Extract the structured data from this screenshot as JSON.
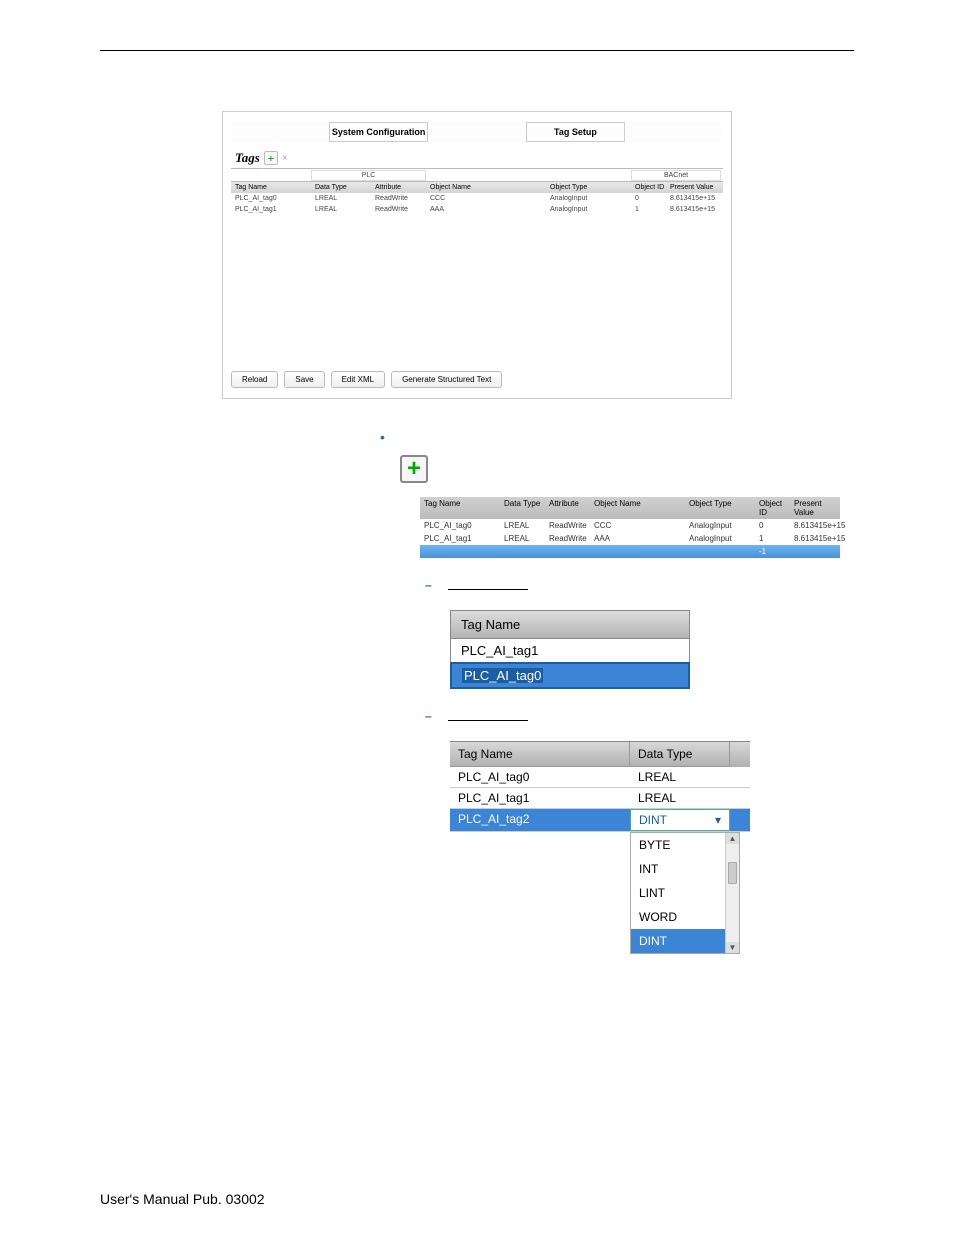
{
  "fig1": {
    "tab_sys": "System Configuration",
    "tab_tag": "Tag Setup",
    "tags_label": "Tags",
    "group_plc": "PLC",
    "group_bacnet": "BACnet",
    "cols": {
      "tag_name": "Tag Name",
      "data_type": "Data Type",
      "attribute": "Attribute",
      "object_name": "Object Name",
      "object_type": "Object Type",
      "object_id": "Object ID",
      "present_value": "Present Value"
    },
    "rows": [
      {
        "tag": "PLC_AI_tag0",
        "dt": "LREAL",
        "attr": "ReadWrite",
        "on": "CCC",
        "ot": "AnalogInput",
        "oid": "0",
        "pv": "8.613415e+15"
      },
      {
        "tag": "PLC_AI_tag1",
        "dt": "LREAL",
        "attr": "ReadWrite",
        "on": "AAA",
        "ot": "AnalogInput",
        "oid": "1",
        "pv": "8.613415e+15"
      }
    ],
    "btn_reload": "Reload",
    "btn_save": "Save",
    "btn_edit": "Edit XML",
    "btn_gen": "Generate Structured Text"
  },
  "fig2": {
    "rows": [
      {
        "tag": "PLC_AI_tag0",
        "dt": "LREAL",
        "attr": "ReadWrite",
        "on": "CCC",
        "ot": "AnalogInput",
        "oid": "0",
        "pv": "8.613415e+15"
      },
      {
        "tag": "PLC_AI_tag1",
        "dt": "LREAL",
        "attr": "ReadWrite",
        "on": "AAA",
        "ot": "AnalogInput",
        "oid": "1",
        "pv": "8.613415e+15"
      }
    ],
    "hl_oid": "-1"
  },
  "fig3": {
    "header": "Tag Name",
    "r1": "PLC_AI_tag1",
    "r2": "PLC_AI_tag0"
  },
  "fig4": {
    "h1": "Tag Name",
    "h2": "Data Type",
    "rows": [
      {
        "tag": "PLC_AI_tag0",
        "dt": "LREAL"
      },
      {
        "tag": "PLC_AI_tag1",
        "dt": "LREAL"
      },
      {
        "tag": "PLC_AI_tag2",
        "dt": "DINT"
      }
    ],
    "dd": [
      "BYTE",
      "INT",
      "LINT",
      "WORD",
      "DINT"
    ]
  },
  "footer": "User's Manual Pub. 03002"
}
